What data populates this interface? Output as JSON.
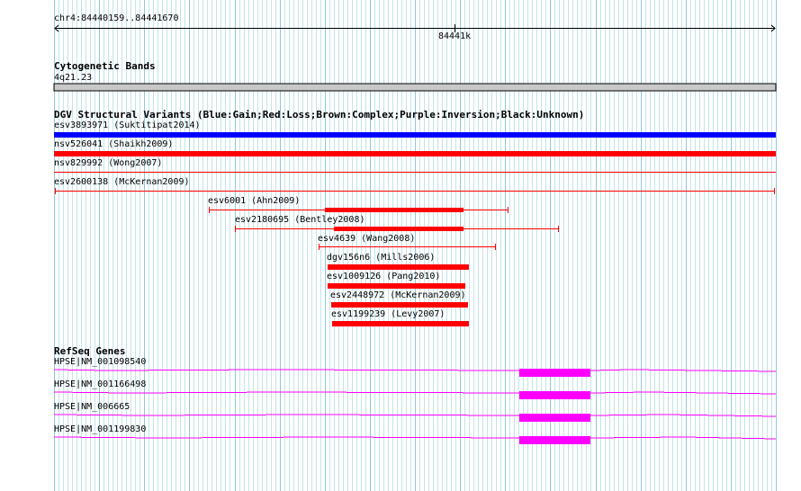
{
  "ruler": {
    "range_label": "chr4:84440159..84441670",
    "tick_label": "84441k"
  },
  "cytoband": {
    "title": "Cytogenetic Bands",
    "band_label": "4q21.23"
  },
  "dgv": {
    "title": "DGV Structural Variants (Blue:Gain;Red:Loss;Brown:Complex;Purple:Inversion;Black:Unknown)",
    "colors": {
      "gain": "#0000ff",
      "loss": "#ff0000"
    },
    "variants": [
      {
        "label": "esv3893971 (Suktitipat2014)",
        "type": "gain",
        "style": "full-bar"
      },
      {
        "label": "nsv526041 (Shaikh2009)",
        "type": "loss",
        "style": "full-bar"
      },
      {
        "label": "nsv829992 (Wong2007)",
        "type": "loss",
        "style": "full-line"
      },
      {
        "label": "esv2600138 (McKernan2009)",
        "type": "loss",
        "style": "full-whisker"
      },
      {
        "label": "esv6001 (Ahn2009)",
        "type": "loss",
        "style": "whisker"
      },
      {
        "label": "esv2180695 (Bentley2008)",
        "type": "loss",
        "style": "whisker"
      },
      {
        "label": "esv4639 (Wang2008)",
        "type": "loss",
        "style": "whisker"
      },
      {
        "label": "dgv156n6 (Mills2006)",
        "type": "loss",
        "style": "bar"
      },
      {
        "label": "esv1009126 (Pang2010)",
        "type": "loss",
        "style": "bar"
      },
      {
        "label": "esv2448972 (McKernan2009)",
        "type": "loss",
        "style": "bar"
      },
      {
        "label": "esv1199239 (Levy2007)",
        "type": "loss",
        "style": "bar"
      }
    ]
  },
  "refseq": {
    "title": "RefSeq Genes",
    "color": "#ff00ff",
    "genes": [
      {
        "label": "HPSE|NM_001098540"
      },
      {
        "label": "HPSE|NM_001166498"
      },
      {
        "label": "HPSE|NM_006665"
      },
      {
        "label": "HPSE|NM_001199830"
      }
    ]
  }
}
